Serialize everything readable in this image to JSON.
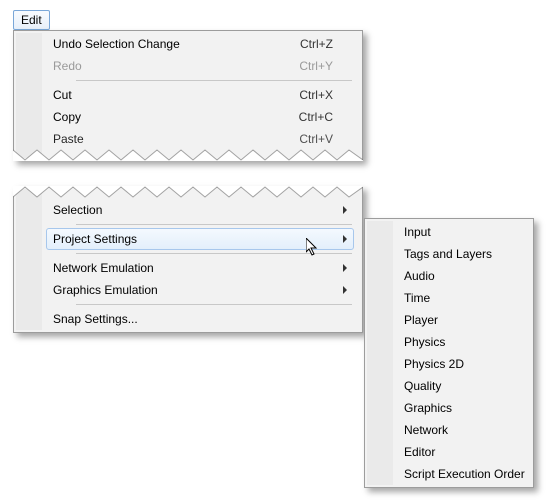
{
  "menubar": {
    "edit": "Edit"
  },
  "top_menu": {
    "undo": {
      "label": "Undo Selection Change",
      "shortcut": "Ctrl+Z"
    },
    "redo": {
      "label": "Redo",
      "shortcut": "Ctrl+Y"
    },
    "cut": {
      "label": "Cut",
      "shortcut": "Ctrl+X"
    },
    "copy": {
      "label": "Copy",
      "shortcut": "Ctrl+C"
    },
    "paste": {
      "label": "Paste",
      "shortcut": "Ctrl+V"
    }
  },
  "mid_menu": {
    "selection": {
      "label": "Selection"
    },
    "project_settings": {
      "label": "Project Settings"
    },
    "network_emulation": {
      "label": "Network Emulation"
    },
    "graphics_emulation": {
      "label": "Graphics Emulation"
    },
    "snap_settings": {
      "label": "Snap Settings..."
    }
  },
  "submenu": {
    "input": "Input",
    "tags": "Tags and Layers",
    "audio": "Audio",
    "time": "Time",
    "player": "Player",
    "physics": "Physics",
    "physics2d": "Physics 2D",
    "quality": "Quality",
    "graphics": "Graphics",
    "network": "Network",
    "editor": "Editor",
    "script_order": "Script Execution Order"
  }
}
